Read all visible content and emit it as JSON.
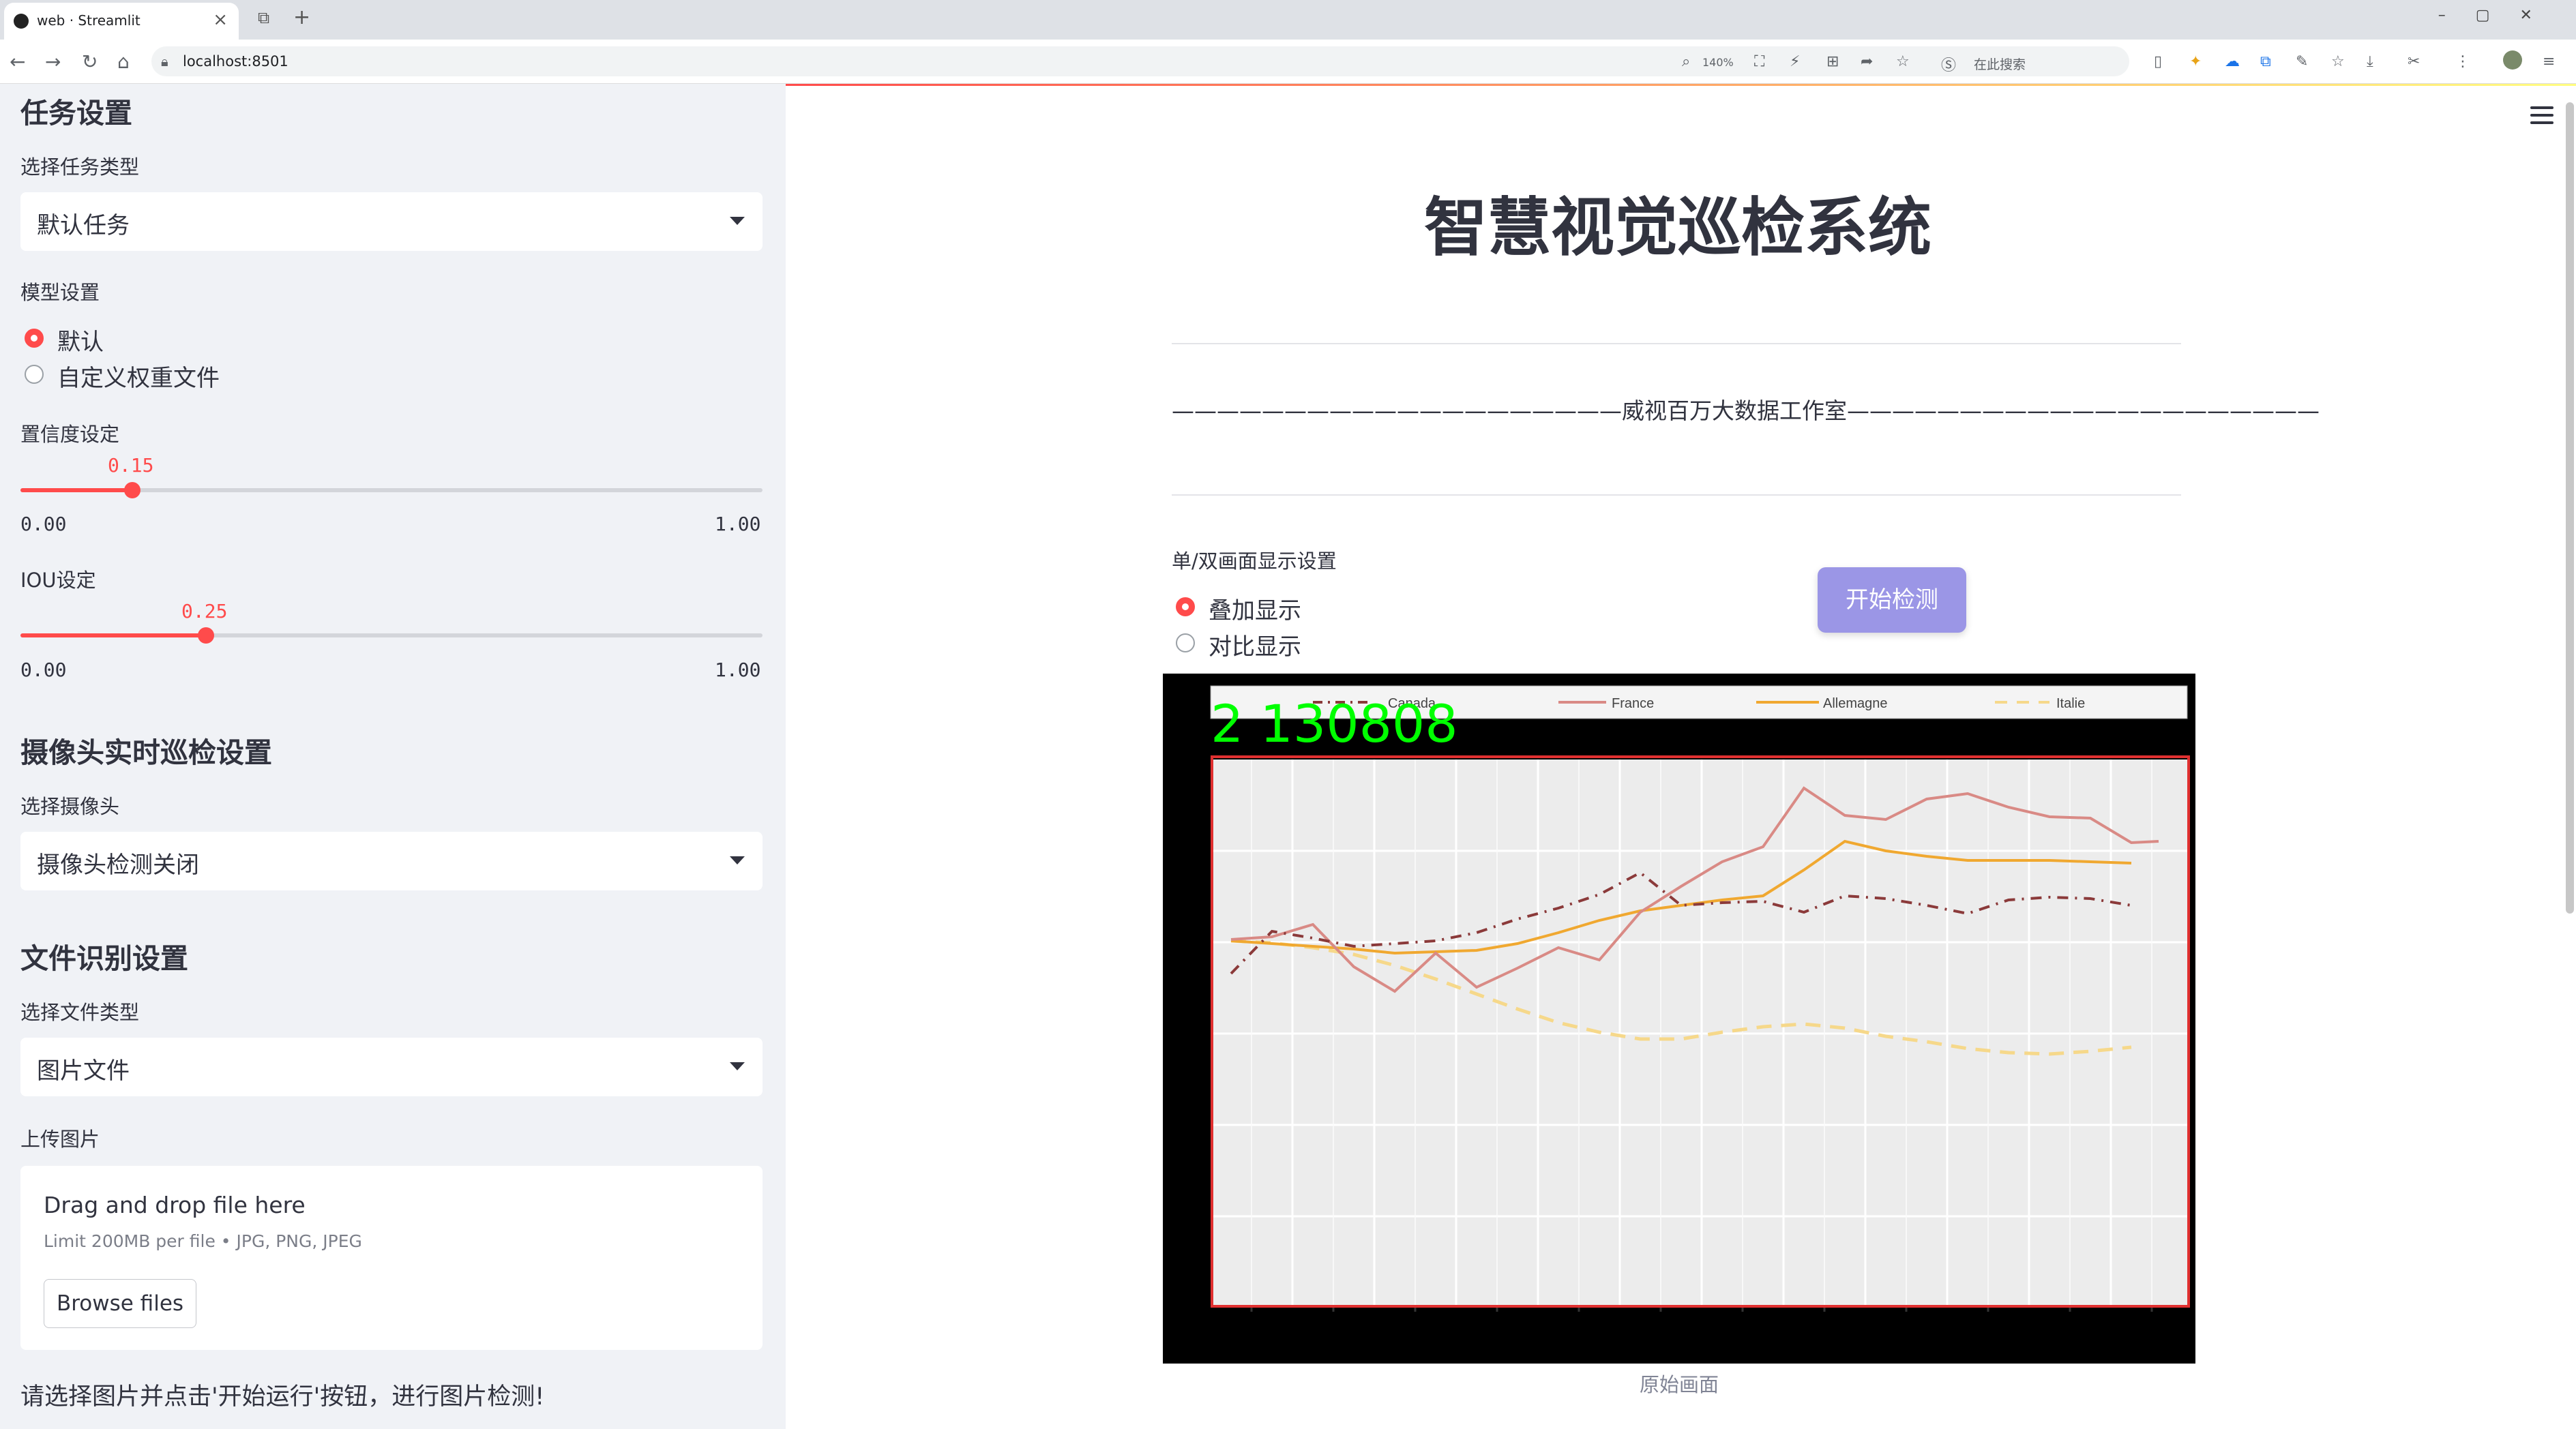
{
  "browser": {
    "tab_title": "web · Streamlit",
    "url": "localhost:8501",
    "zoom": "140%",
    "search_placeholder": "在此搜索"
  },
  "sidebar": {
    "task_heading": "任务设置",
    "task_type_label": "选择任务类型",
    "task_type_value": "默认任务",
    "model_label": "模型设置",
    "model_options": [
      "默认",
      "自定义权重文件"
    ],
    "model_selected": "默认",
    "conf_label": "置信度设定",
    "conf_value": "0.15",
    "conf_min": "0.00",
    "conf_max": "1.00",
    "iou_label": "IOU设定",
    "iou_value": "0.25",
    "iou_min": "0.00",
    "iou_max": "1.00",
    "camera_heading": "摄像头实时巡检设置",
    "camera_label": "选择摄像头",
    "camera_value": "摄像头检测关闭",
    "file_heading": "文件识别设置",
    "file_type_label": "选择文件类型",
    "file_type_value": "图片文件",
    "upload_label": "上传图片",
    "drop_text": "Drag and drop file here",
    "drop_limit": "Limit 200MB per file • JPG, PNG, JPEG",
    "browse_label": "Browse files",
    "hint": "请选择图片并点击'开始运行'按钮，进行图片检测!"
  },
  "main": {
    "title": "智慧视觉巡检系统",
    "studio_line": "————————————————————威视百万大数据工作室—————————————————————",
    "display_label": "单/双画面显示设置",
    "display_options": [
      "叠加显示",
      "对比显示"
    ],
    "display_selected": "叠加显示",
    "start_button": "开始检测",
    "image_caption": "原始画面",
    "overlay_text": "2  130808",
    "legend": [
      "Canada",
      "France",
      "Allemagne",
      "Italie"
    ]
  },
  "colors": {
    "accent": "#ff4b4b",
    "button": "#9b96e6",
    "sidebar_bg": "#f0f2f6",
    "detect_box": "#e03030",
    "overlay_text": "#00ff00"
  }
}
